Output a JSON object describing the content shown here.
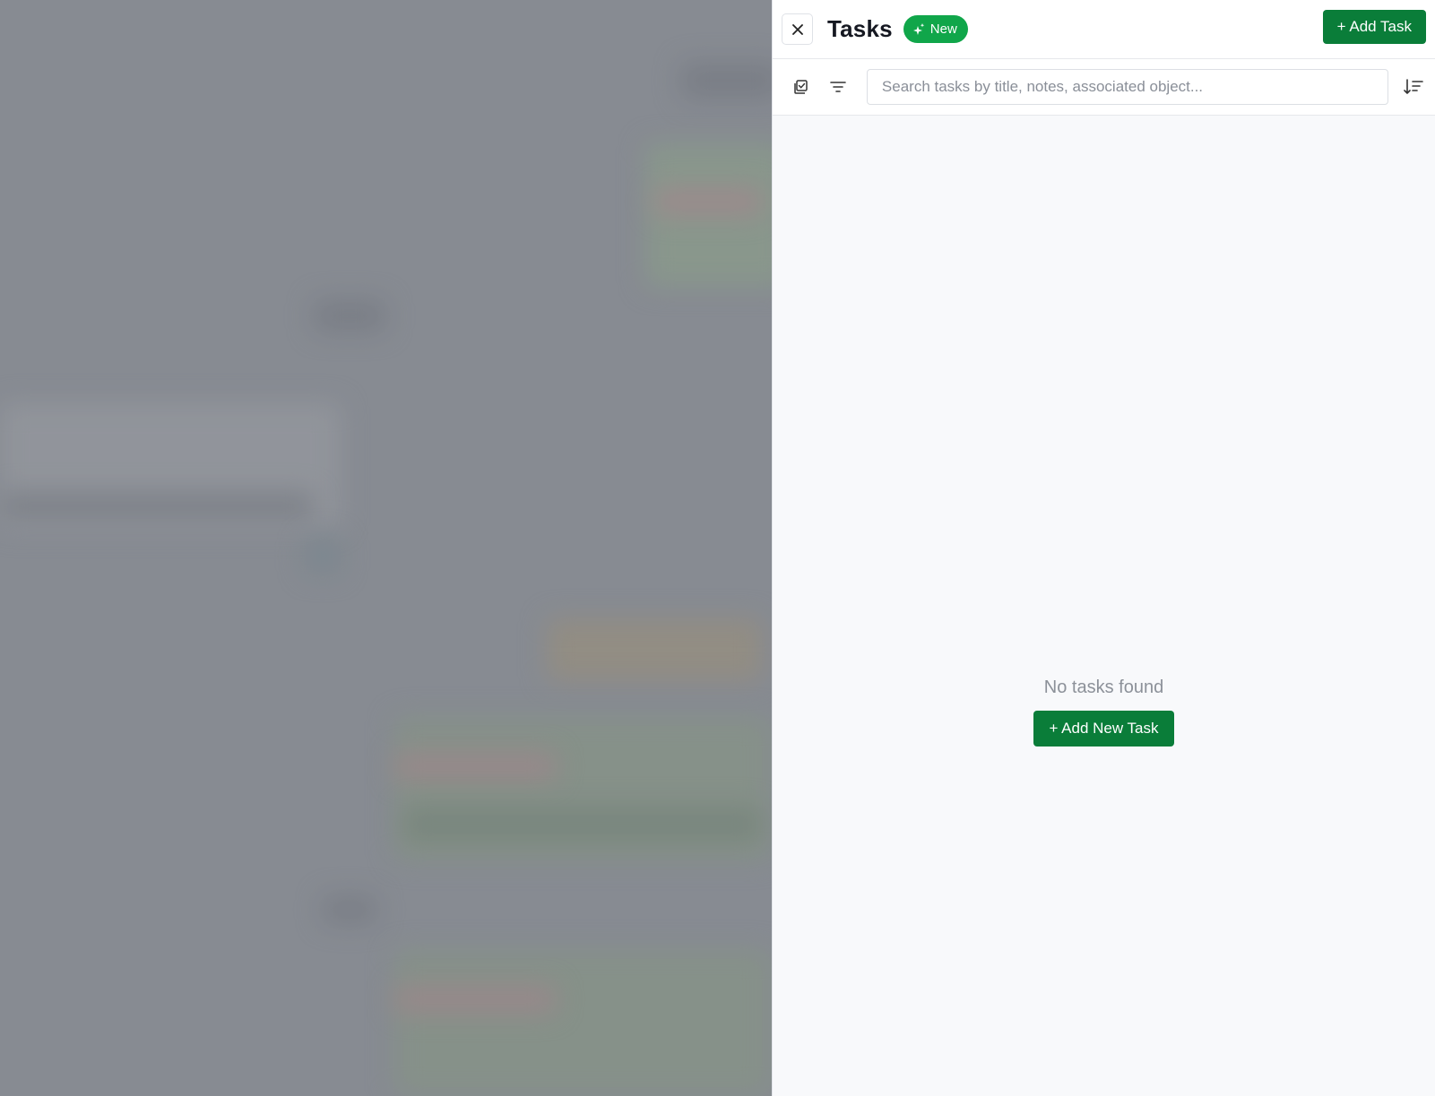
{
  "drawer": {
    "title": "Tasks",
    "badge": "New",
    "add_task_label": "+ Add Task",
    "close_icon": "close-icon",
    "sparkle_icon": "sparkle-icon"
  },
  "toolbar": {
    "view_icon": "checklist-icon",
    "filter_icon": "filter-icon",
    "search_placeholder": "Search tasks by title, notes, associated object...",
    "search_value": "",
    "sort_icon": "sort-descending-icon"
  },
  "empty_state": {
    "message": "No tasks found",
    "add_new_label": "+ Add New Task"
  },
  "colors": {
    "accent": "#0a7d39",
    "badge": "#10a64a",
    "overlay": "#8c9097"
  }
}
